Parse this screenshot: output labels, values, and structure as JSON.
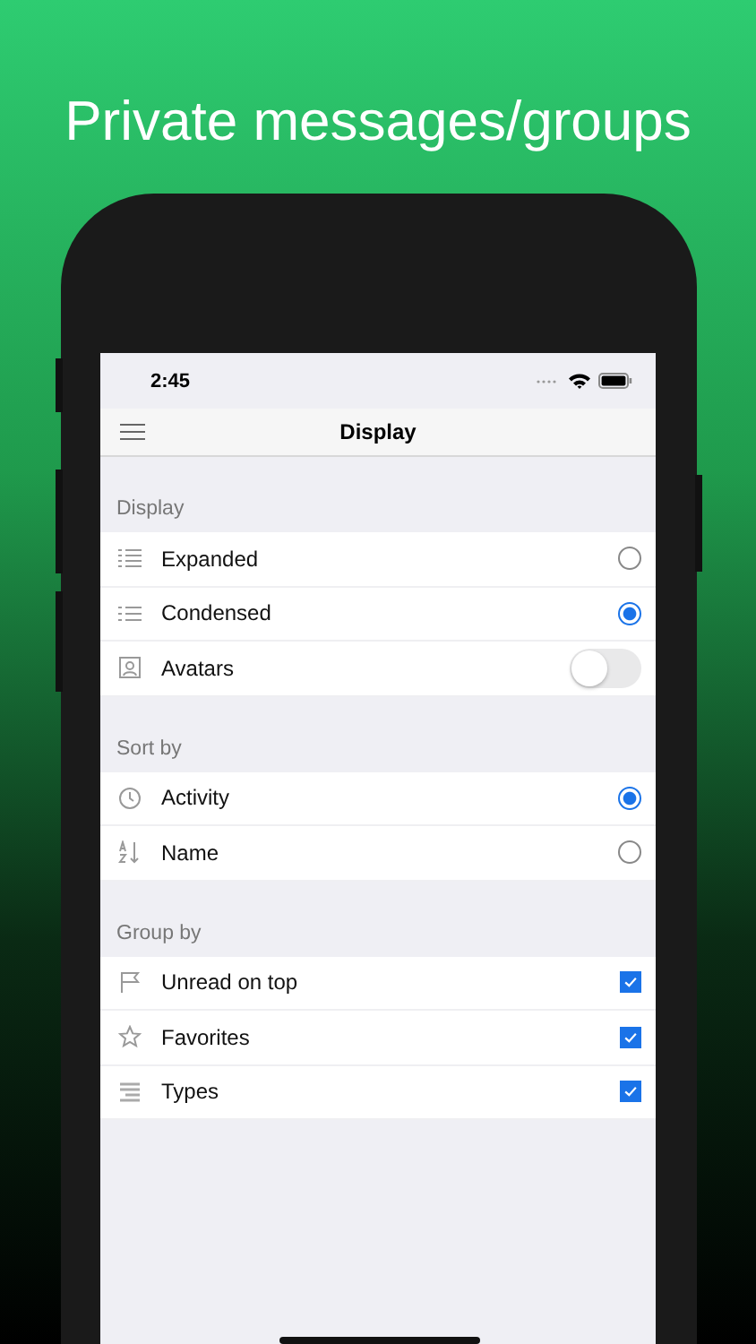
{
  "headline": "Private messages/groups",
  "status_bar": {
    "time": "2:45"
  },
  "nav": {
    "title": "Display"
  },
  "sections": [
    {
      "title": "Display",
      "rows": [
        {
          "kind": "radio",
          "label": "Expanded",
          "selected": false
        },
        {
          "kind": "radio",
          "label": "Condensed",
          "selected": true
        },
        {
          "kind": "toggle",
          "label": "Avatars",
          "on": false
        }
      ]
    },
    {
      "title": "Sort by",
      "rows": [
        {
          "kind": "radio",
          "label": "Activity",
          "selected": true
        },
        {
          "kind": "radio",
          "label": "Name",
          "selected": false
        }
      ]
    },
    {
      "title": "Group by",
      "rows": [
        {
          "kind": "checkbox",
          "label": "Unread on top",
          "checked": true
        },
        {
          "kind": "checkbox",
          "label": "Favorites",
          "checked": true
        },
        {
          "kind": "checkbox",
          "label": "Types",
          "checked": true
        }
      ]
    }
  ]
}
